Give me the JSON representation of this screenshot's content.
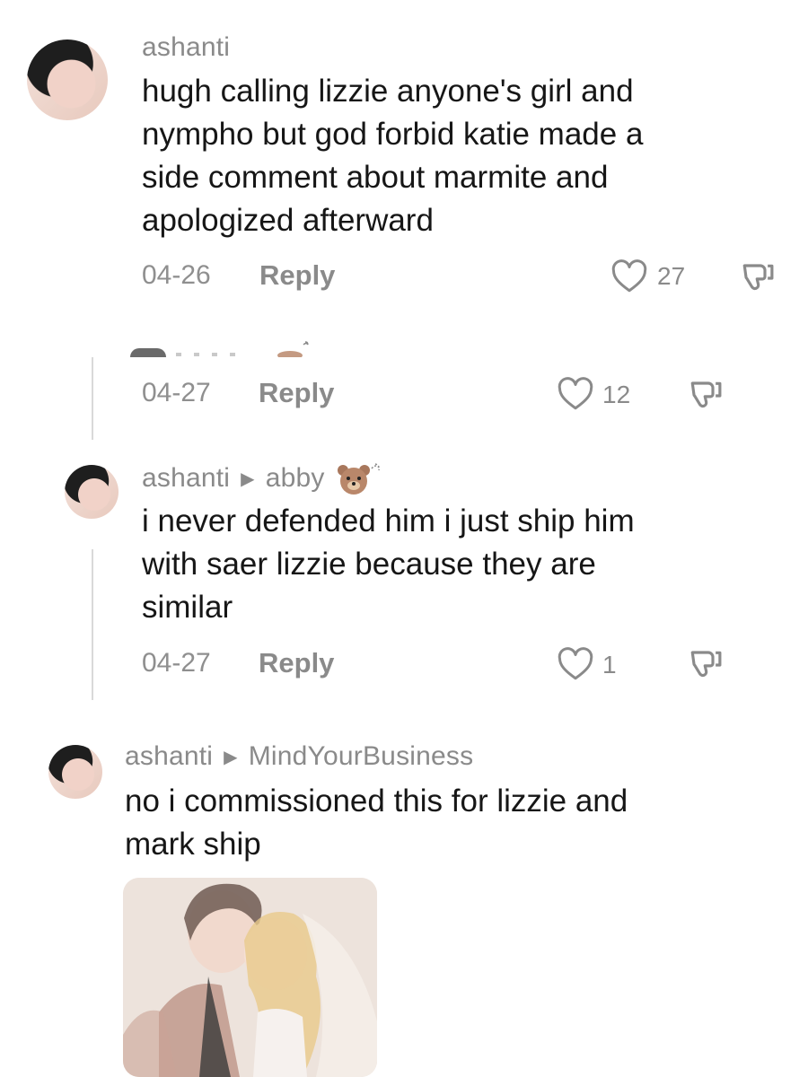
{
  "comments": [
    {
      "username": "ashanti",
      "text_lines": [
        "hugh calling lizzie anyone's girl and",
        "nympho but god forbid katie made a",
        "side comment about marmite and",
        "apologized afterward"
      ],
      "date": "04-26",
      "reply_label": "Reply",
      "likes": "27"
    },
    {
      "date": "04-27",
      "reply_label": "Reply",
      "likes": "12"
    },
    {
      "username": "ashanti",
      "reply_to": "abby",
      "text_lines": [
        "i never defended him i just ship him",
        "with saer lizzie because they are",
        "similar"
      ],
      "date": "04-27",
      "reply_label": "Reply",
      "likes": "1"
    },
    {
      "username": "ashanti",
      "reply_to": "MindYourBusiness",
      "text_lines": [
        "no i commissioned this for lizzie and",
        "mark ship"
      ]
    }
  ],
  "icons": {
    "like": "heart-outline-icon",
    "dislike": "thumbs-down-icon",
    "reply_arrow": "triangle-right-icon",
    "emoji": "bear-emoji-icon"
  },
  "colors": {
    "text": "#161616",
    "secondary": "#8a8a8a",
    "thread_line": "#d9d9d9"
  }
}
